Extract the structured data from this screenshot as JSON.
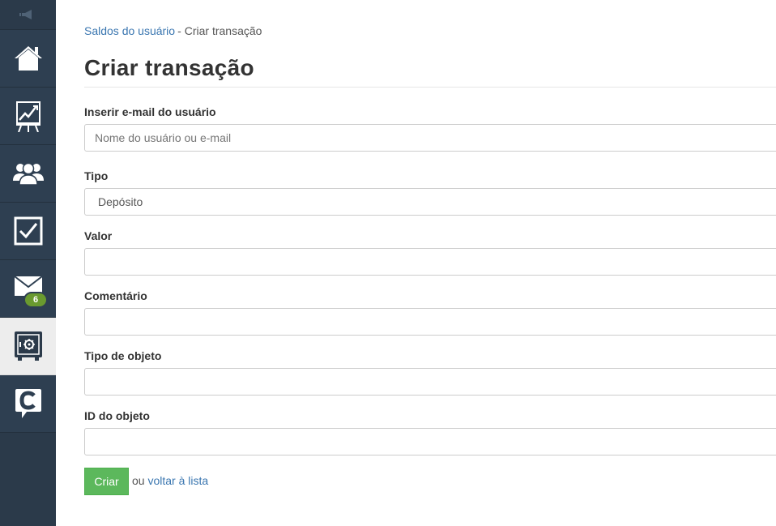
{
  "breadcrumb": {
    "link": "Saldos do usuário",
    "separator": "-",
    "current": "Criar transação"
  },
  "page_title": "Criar transação",
  "form": {
    "email_label": "Inserir e-mail do usuário",
    "email_placeholder": "Nome do usuário ou e-mail",
    "type_label": "Tipo",
    "type_value": "Depósito",
    "value_label": "Valor",
    "comment_label": "Comentário",
    "object_type_label": "Tipo de objeto",
    "object_id_label": "ID do objeto",
    "submit_label": "Criar",
    "or_text": "ou",
    "back_link": "voltar à lista"
  },
  "sidebar": {
    "items": [
      {
        "icon": "megaphone-icon"
      },
      {
        "icon": "home-icon"
      },
      {
        "icon": "chart-board-icon"
      },
      {
        "icon": "users-icon"
      },
      {
        "icon": "checkbox-icon"
      },
      {
        "icon": "mail-icon",
        "badge": "6"
      },
      {
        "icon": "safe-icon",
        "active": true
      },
      {
        "icon": "chat-logo-icon"
      }
    ]
  },
  "colors": {
    "sidebar": "#2b3a4a",
    "accent_link": "#3a76b0",
    "button": "#5cb85c",
    "badge": "#6a9a2f"
  }
}
